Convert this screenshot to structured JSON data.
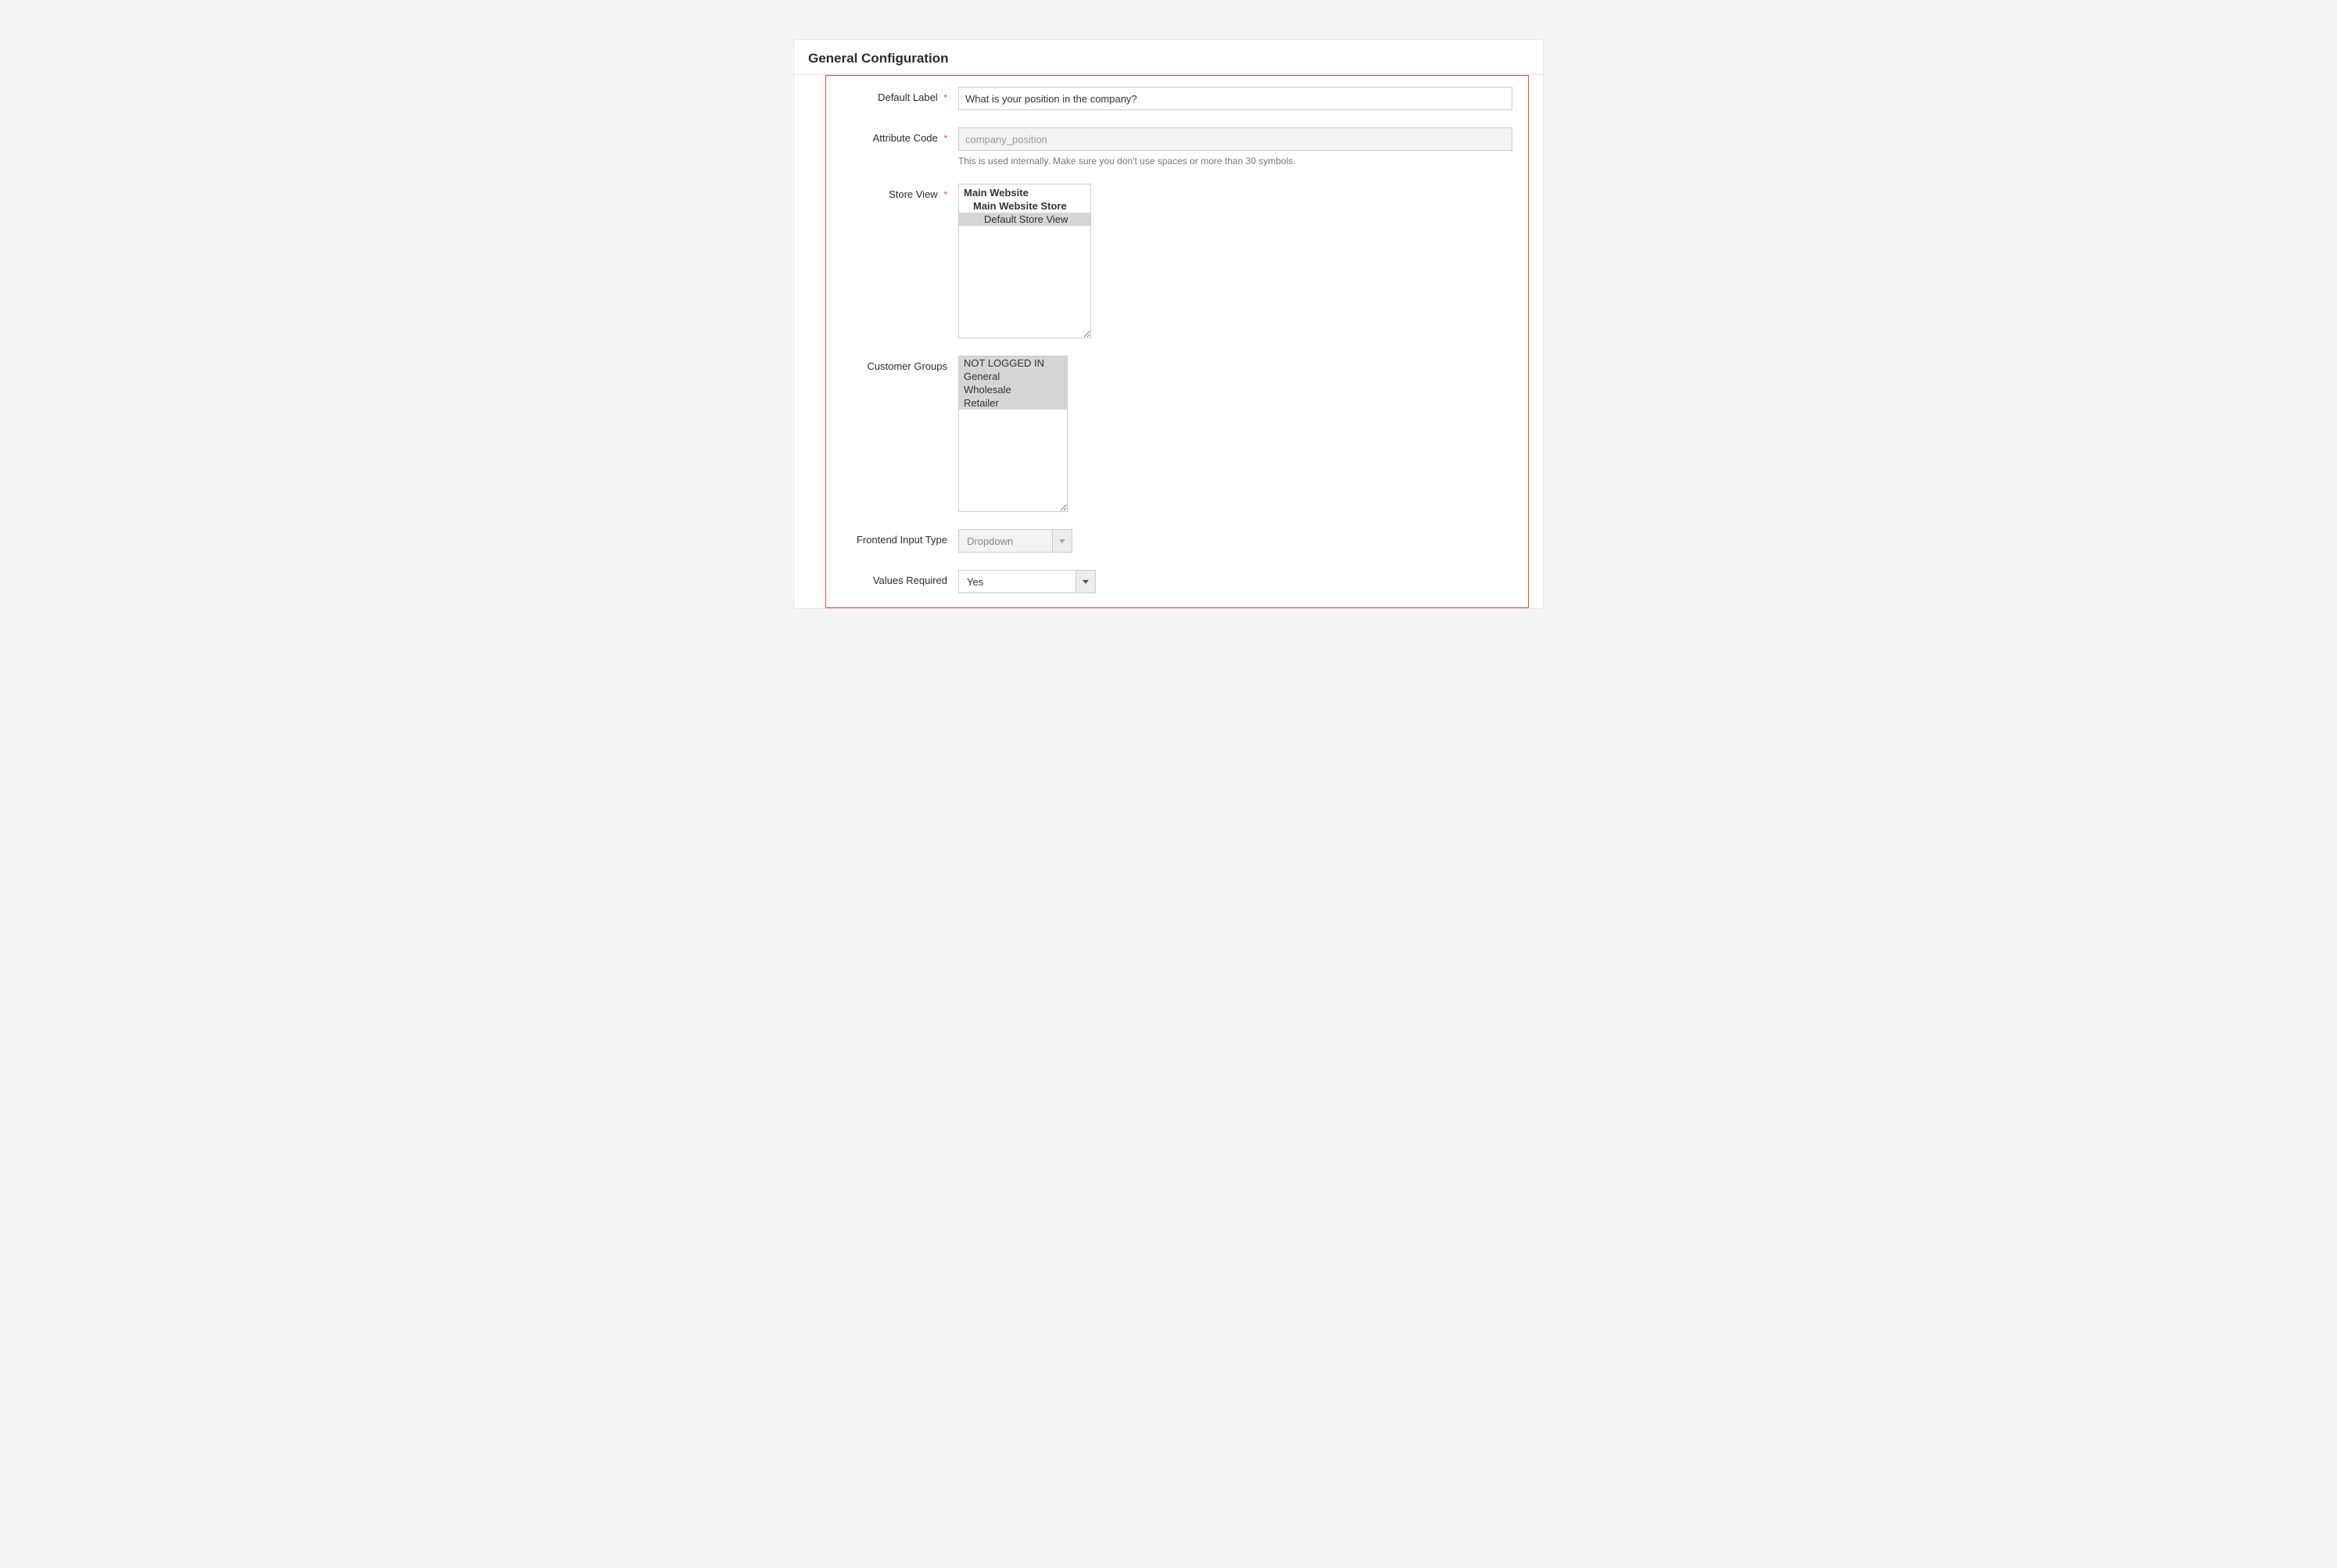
{
  "panel": {
    "title": "General Configuration"
  },
  "fields": {
    "default_label": {
      "label": "Default Label",
      "required": true,
      "value": "What is your position in the company?"
    },
    "attribute_code": {
      "label": "Attribute Code",
      "required": true,
      "value": "company_position",
      "help": "This is used internally. Make sure you don't use spaces or more than 30 symbols."
    },
    "store_view": {
      "label": "Store View",
      "required": true,
      "options": [
        {
          "label": "Main Website",
          "level": 0,
          "selected": false
        },
        {
          "label": "Main Website Store",
          "level": 1,
          "selected": false
        },
        {
          "label": "Default Store View",
          "level": 2,
          "selected": true
        }
      ]
    },
    "customer_groups": {
      "label": "Customer Groups",
      "required": false,
      "options": [
        {
          "label": "NOT LOGGED IN",
          "selected": true
        },
        {
          "label": "General",
          "selected": true
        },
        {
          "label": "Wholesale",
          "selected": true
        },
        {
          "label": "Retailer",
          "selected": true
        }
      ]
    },
    "frontend_input_type": {
      "label": "Frontend Input Type",
      "required": false,
      "value": "Dropdown",
      "disabled": true
    },
    "values_required": {
      "label": "Values Required",
      "required": false,
      "value": "Yes",
      "disabled": false
    }
  },
  "required_marker": "*"
}
